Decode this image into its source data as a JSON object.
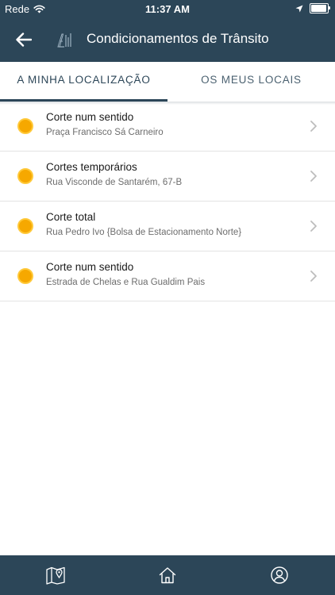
{
  "status_bar": {
    "carrier": "Rede",
    "time": "11:37 AM",
    "battery_level_percent": 95
  },
  "nav": {
    "title": "Condicionamentos de Trânsito"
  },
  "tabs": [
    {
      "label": "A MINHA LOCALIZAÇÃO",
      "active": true
    },
    {
      "label": "OS MEUS LOCAIS",
      "active": false
    }
  ],
  "items": [
    {
      "title": "Corte num sentido",
      "subtitle": "Praça Francisco Sá Carneiro"
    },
    {
      "title": "Cortes temporários",
      "subtitle": "Rua Visconde de Santarém, 67-B"
    },
    {
      "title": "Corte total",
      "subtitle": "Rua Pedro Ivo {Bolsa de Estacionamento Norte}"
    },
    {
      "title": "Corte num sentido",
      "subtitle": "Estrada de Chelas e Rua Gualdim Pais"
    }
  ],
  "bottom_nav": [
    {
      "icon": "map-pin-icon"
    },
    {
      "icon": "home-icon"
    },
    {
      "icon": "user-icon"
    }
  ],
  "colors": {
    "brand": "#2c4658",
    "status_dot": "#f6a800",
    "status_dot_ring": "#ffc93a"
  }
}
